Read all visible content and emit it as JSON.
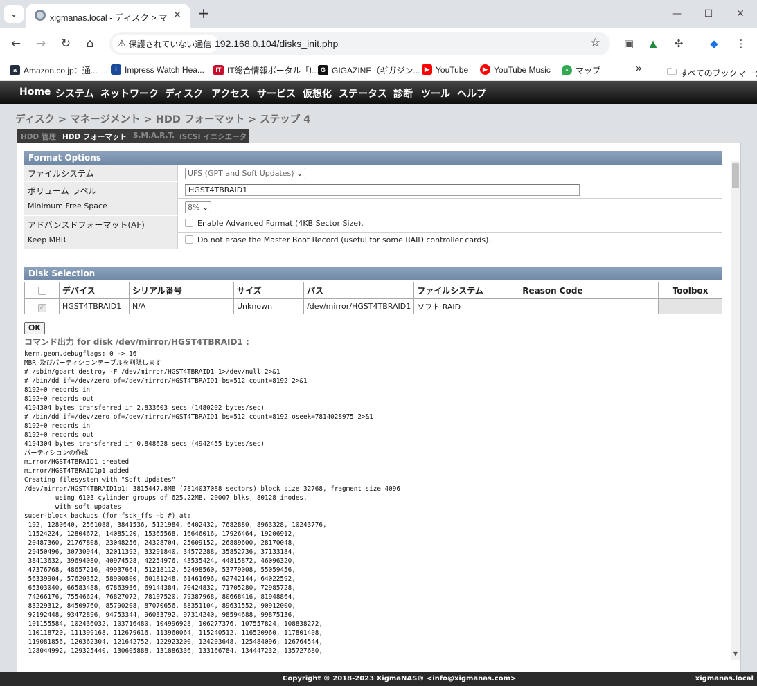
{
  "browser": {
    "tab_title": "xigmanas.local - ディスク > マネー",
    "tab_close": "✕",
    "new_tab": "+",
    "security_label": "保護されていない通信",
    "url": "192.168.0.104/disks_init.php",
    "bookmarks": [
      {
        "label": "Amazon.co.jp：通...",
        "icon": "amazon-icon",
        "color": "#232f3e"
      },
      {
        "label": "Impress Watch Hea...",
        "icon": "impress-icon",
        "color": "#1a4a9a"
      },
      {
        "label": "IT総合情報ポータル「I...",
        "icon": "itmedia-icon",
        "color": "#c8102e"
      },
      {
        "label": "GIGAZINE（ギガジン...",
        "icon": "gigazine-icon",
        "color": "#111111"
      },
      {
        "label": "YouTube",
        "icon": "youtube-icon",
        "color": "#ff0000"
      },
      {
        "label": "YouTube Music",
        "icon": "youtube-music-icon",
        "color": "#ff0000"
      },
      {
        "label": "マップ",
        "icon": "maps-icon",
        "color": "#34a853"
      }
    ],
    "bookmarks_overflow": "»",
    "all_bookmarks": "すべてのブックマーク"
  },
  "nav": {
    "menu": [
      "Home",
      "システム",
      "ネットワーク",
      "ディスク",
      "アクセス",
      "サービス",
      "仮想化",
      "ステータス",
      "診断",
      "ツール",
      "ヘルプ"
    ],
    "breadcrumb": "ディスク > マネージメント > HDD フォーマット > ステップ 4",
    "subtabs": [
      "HDD 管理",
      "HDD フォーマット",
      "S.M.A.R.T.",
      "iSCSI イニシエータ"
    ]
  },
  "format_options": {
    "header": "Format Options",
    "filesystem_label": "ファイルシステム",
    "filesystem_value": "UFS (GPT and Soft Updates)",
    "volume_label_label": "ボリューム ラベル",
    "volume_label_value": "HGST4TBRAID1",
    "min_free_label": "Minimum Free Space",
    "min_free_value": "8%",
    "af_label": "アドバンスドフォーマット(AF)",
    "af_text": "Enable Advanced Format (4KB Sector Size).",
    "keep_mbr_label": "Keep MBR",
    "keep_mbr_text": "Do not erase the Master Boot Record (useful for some RAID controller cards)."
  },
  "disk_selection": {
    "header": "Disk Selection",
    "columns": [
      "デバイス",
      "シリアル番号",
      "サイズ",
      "パス",
      "ファイルシステム",
      "Reason Code",
      "Toolbox"
    ],
    "row": [
      "HGST4TBRAID1",
      "N/A",
      "Unknown",
      "/dev/mirror/HGST4TBRAID1",
      "ソフト RAID",
      "",
      ""
    ]
  },
  "ok_label": "OK",
  "command_label": "コマンド出力 for disk /dev/mirror/HGST4TBRAID1 :",
  "command_output": "kern.geom.debugflags: 0 -> 16\nMBR 及びパーティションテーブルを削除します\n# /sbin/gpart destroy -F /dev/mirror/HGST4TBRAID1 1>/dev/null 2>&1\n# /bin/dd if=/dev/zero of=/dev/mirror/HGST4TBRAID1 bs=512 count=8192 2>&1\n8192+0 records in\n8192+0 records out\n4194304 bytes transferred in 2.833603 secs (1480202 bytes/sec)\n# /bin/dd if=/dev/zero of=/dev/mirror/HGST4TBRAID1 bs=512 count=8192 oseek=7814028975 2>&1\n8192+0 records in\n8192+0 records out\n4194304 bytes transferred in 0.848628 secs (4942455 bytes/sec)\nパーティションの作成\nmirror/HGST4TBRAID1 created\nmirror/HGST4TBRAID1p1 added\nCreating filesystem with \"Soft Updates\"\n/dev/mirror/HGST4TBRAID1p1: 3815447.8MB (7814037088 sectors) block size 32768, fragment size 4096\n        using 6103 cylinder groups of 625.22MB, 20007 blks, 80128 inodes.\n        with soft updates\nsuper-block backups (for fsck_ffs -b #) at:\n 192, 1280640, 2561088, 3841536, 5121984, 6402432, 7682880, 8963328, 10243776,\n 11524224, 12804672, 14085120, 15365568, 16646016, 17926464, 19206912,\n 20487360, 21767808, 23048256, 24328704, 25609152, 26889600, 28170048,\n 29450496, 30730944, 32011392, 33291840, 34572288, 35852736, 37133184,\n 38413632, 39694080, 40974528, 42254976, 43535424, 44815872, 46096320,\n 47376768, 48657216, 49937664, 51218112, 52498560, 53779008, 55059456,\n 56339904, 57620352, 58900800, 60181248, 61461696, 62742144, 64022592,\n 65303040, 66583488, 67863936, 69144384, 70424832, 71705280, 72985728,\n 74266176, 75546624, 76827072, 78107520, 79387968, 80668416, 81948864,\n 83229312, 84509760, 85790208, 87070656, 88351104, 89631552, 90912000,\n 92192448, 93472896, 94753344, 96033792, 97314240, 98594688, 99875136,\n 101155584, 102436032, 103716480, 104996928, 106277376, 107557824, 108838272,\n 110118720, 111399168, 112679616, 113960064, 115240512, 116520960, 117801408,\n 119081856, 120362304, 121642752, 122923200, 124203648, 125484096, 126764544,\n 128044992, 129325440, 130605888, 131886336, 133166784, 134447232, 135727680,",
  "footer": {
    "copyright": "Copyright © 2018-2023 XigmaNAS® <info@xigmanas.com>",
    "host": "xigmanas.local"
  }
}
